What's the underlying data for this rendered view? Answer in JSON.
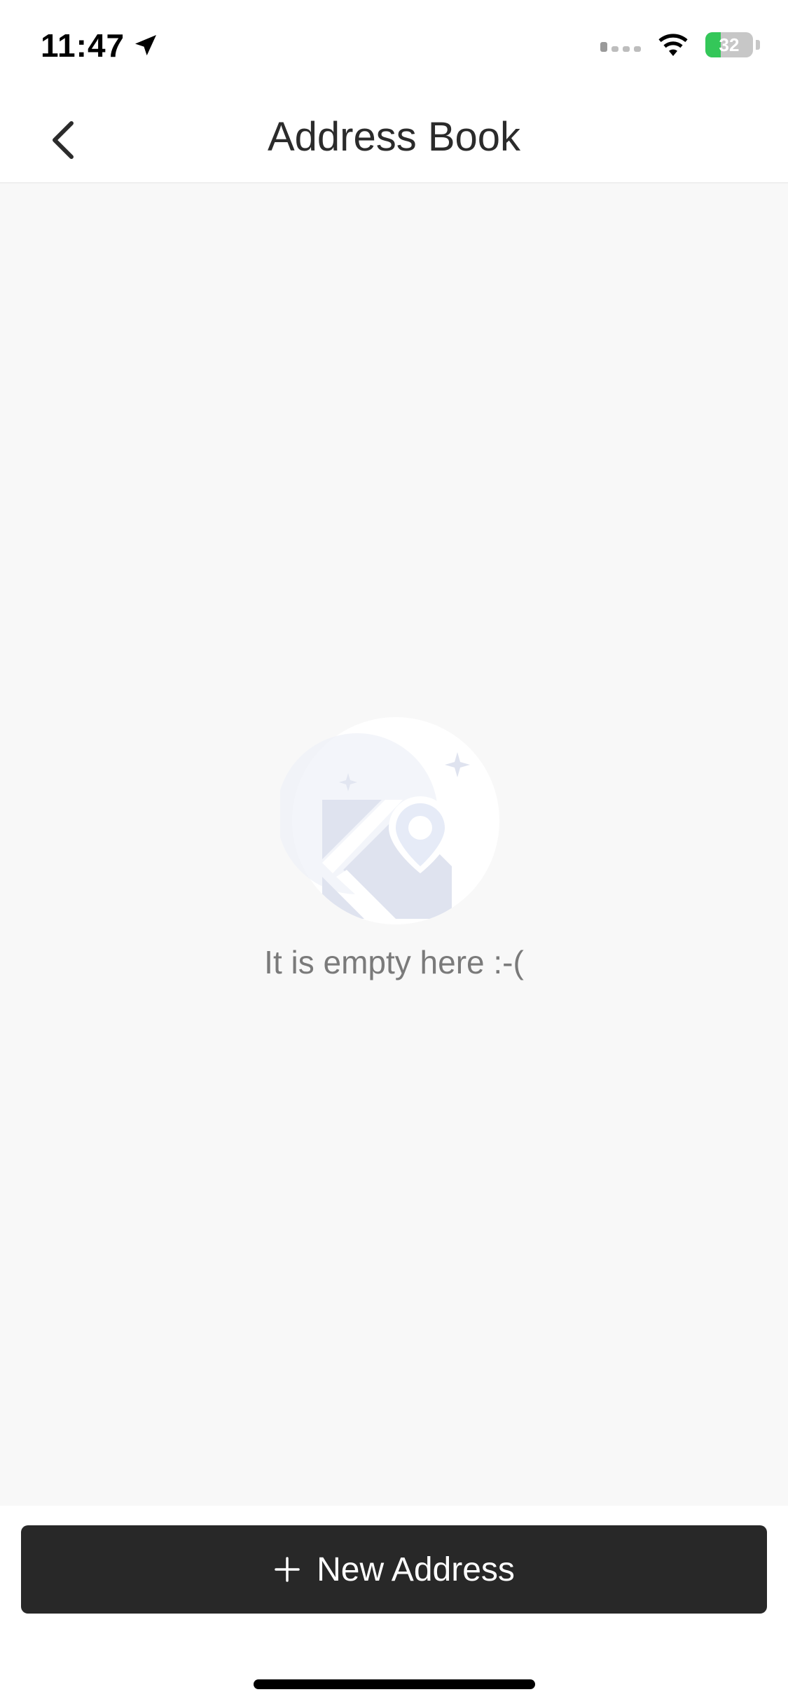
{
  "status_bar": {
    "time": "11:47",
    "location_icon": "location-arrow-icon",
    "signal_icon": "cellular-signal-icon",
    "wifi_icon": "wifi-icon",
    "battery_icon": "battery-charging-icon",
    "battery_level": "32",
    "battery_fraction": 0.32,
    "battery_color": "#34c759"
  },
  "nav": {
    "back_icon": "chevron-left-icon",
    "title": "Address Book"
  },
  "empty_state": {
    "illustration_icon": "map-pin-empty-illustration",
    "message": "It is empty here :-("
  },
  "footer": {
    "plus_icon": "plus-icon",
    "new_address_label": "New Address",
    "button_color": "#282828"
  }
}
